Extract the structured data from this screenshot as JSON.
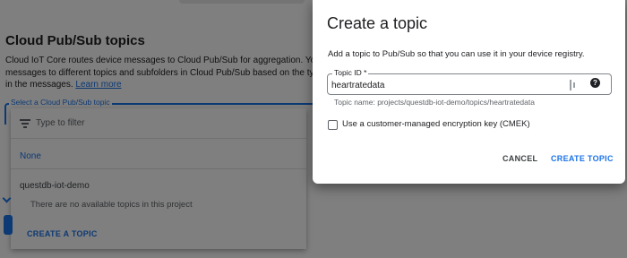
{
  "background": {
    "heading": "Cloud Pub/Sub topics",
    "description_lines": [
      "Cloud IoT Core routes device messages to Cloud Pub/Sub for aggregation. You can route",
      "messages to different topics and subfolders in Cloud Pub/Sub based on the type of data",
      "in the messages."
    ],
    "learn_more": "Learn more",
    "select_label": "Select a Cloud Pub/Sub topic",
    "dropdown": {
      "filter_placeholder": "Type to filter",
      "none_option": "None",
      "project_name": "questdb-iot-demo",
      "empty_message": "There are no available topics in this project",
      "create_topic": "CREATE A TOPIC"
    }
  },
  "dialog": {
    "title": "Create a topic",
    "subtitle": "Add a topic to Pub/Sub so that you can use it in your device registry.",
    "topic_id_label": "Topic ID *",
    "topic_id_value": "heartratedata",
    "topic_name_hint": "Topic name: projects/questdb-iot-demo/topics/heartratedata",
    "help_glyph": "?",
    "cmek_label": "Use a customer-managed encryption key (CMEK)",
    "cmek_checked": false,
    "cancel_label": "CANCEL",
    "create_label": "CREATE TOPIC"
  },
  "colors": {
    "accent": "#1a73e8",
    "text": "#202124",
    "muted": "#5f6368",
    "scrim": "rgba(0,0,0,0.5)"
  },
  "icons": {
    "filter": "filter-list-icon",
    "key": "key-icon",
    "help": "help-icon",
    "chevron": "chevron-down-icon"
  }
}
